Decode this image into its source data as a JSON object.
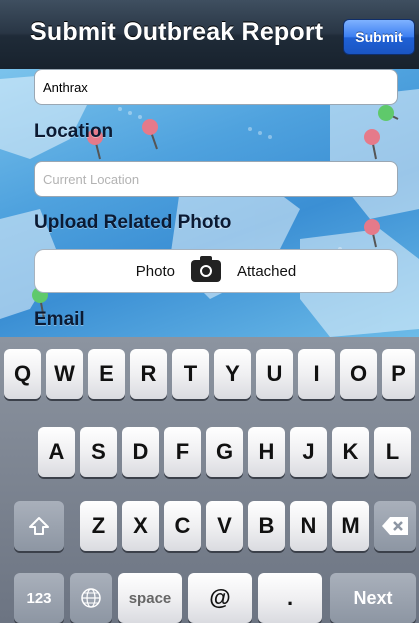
{
  "navbar": {
    "title": "Submit Outbreak Report",
    "submit_label": "Submit"
  },
  "form": {
    "disease_value": "Anthrax",
    "location_label": "Location",
    "location_placeholder": "Current Location",
    "photo_label": "Upload Related Photo",
    "photo_left": "Photo",
    "photo_right": "Attached",
    "email_label": "Email"
  },
  "keyboard": {
    "row1": [
      "Q",
      "W",
      "E",
      "R",
      "T",
      "Y",
      "U",
      "I",
      "O",
      "P"
    ],
    "row2": [
      "A",
      "S",
      "D",
      "F",
      "G",
      "H",
      "J",
      "K",
      "L"
    ],
    "row3": [
      "Z",
      "X",
      "C",
      "V",
      "B",
      "N",
      "M"
    ],
    "numbers_key": "123",
    "space_key": "space",
    "at_key": "@",
    "dot_key": ".",
    "next_key": "Next"
  },
  "icons": {
    "camera": "camera-icon",
    "shift": "shift-arrow-icon",
    "backspace": "backspace-icon",
    "globe": "globe-icon"
  }
}
